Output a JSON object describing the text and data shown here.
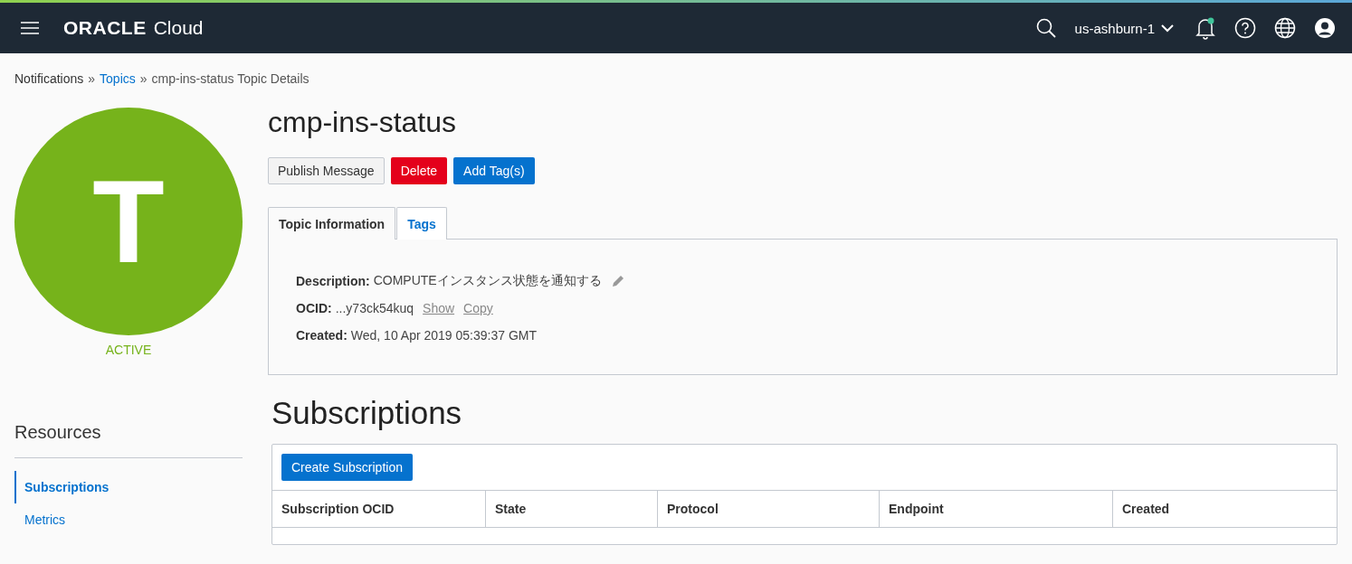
{
  "header": {
    "logo": "ORACLE",
    "product": "Cloud",
    "region": "us-ashburn-1",
    "notification_dot": true
  },
  "breadcrumb": [
    {
      "label": "Notifications",
      "link": false
    },
    {
      "label": "»",
      "link": false
    },
    {
      "label": "Topics",
      "link": true
    },
    {
      "label": "»",
      "link": false
    },
    {
      "label": "cmp-ins-status Topic Details",
      "link": false
    }
  ],
  "avatar": {
    "letter": "T",
    "status": "ACTIVE",
    "color": "#76b31b"
  },
  "title": "cmp-ins-status",
  "buttons": [
    {
      "label": "Publish Message",
      "kind": "default"
    },
    {
      "label": "Delete",
      "kind": "danger"
    },
    {
      "label": "Add Tag(s)",
      "kind": "primary"
    }
  ],
  "tabs": [
    {
      "label": "Topic Information",
      "selected": true
    },
    {
      "label": "Tags",
      "selected": false
    }
  ],
  "details": [
    {
      "label": "Description:",
      "value": "COMPUTEインスタンス状態を通知する",
      "editable": true
    },
    {
      "label": "OCID:",
      "value": "...y73ck54kuq",
      "editable": false,
      "actions": [
        "Show",
        "Copy"
      ]
    },
    {
      "label": "Created:",
      "value": "Wed, 10 Apr 2019 05:39:37 GMT",
      "editable": false
    }
  ],
  "resources": {
    "title": "Resources",
    "items": [
      {
        "label": "Subscriptions",
        "selected": true
      },
      {
        "label": "Metrics",
        "selected": false
      }
    ]
  },
  "subscriptions": {
    "title": "Subscriptions",
    "create_button": "Create Subscription",
    "columns": [
      "Subscription OCID",
      "State",
      "Protocol",
      "Endpoint",
      "Created"
    ]
  }
}
